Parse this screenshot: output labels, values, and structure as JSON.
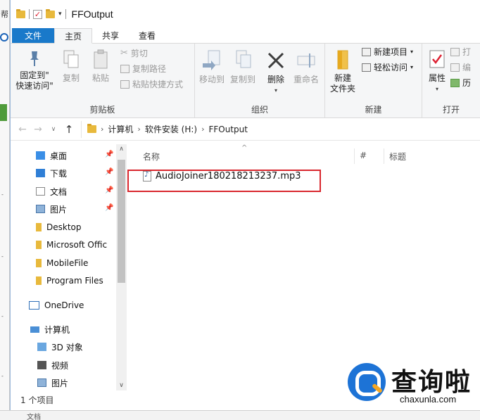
{
  "background_app": {
    "label_char": "帮",
    "bottom_text": "文档"
  },
  "window": {
    "title": "FFOutput"
  },
  "tabs": {
    "file": "文件",
    "home": "主页",
    "share": "共享",
    "view": "查看"
  },
  "ribbon": {
    "clipboard": {
      "label": "剪贴板",
      "pin_line1": "固定到\"",
      "pin_line2": "快速访问\"",
      "copy": "复制",
      "paste": "粘贴",
      "cut": "剪切",
      "copy_path": "复制路径",
      "paste_shortcut": "粘贴快捷方式"
    },
    "organize": {
      "label": "组织",
      "move_to": "移动到",
      "copy_to": "复制到",
      "delete": "删除",
      "rename": "重命名"
    },
    "new": {
      "label": "新建",
      "new_folder_line1": "新建",
      "new_folder_line2": "文件夹",
      "new_item": "新建项目",
      "easy_access": "轻松访问"
    },
    "open": {
      "label": "打开",
      "properties": "属性",
      "open": "打",
      "edit": "编",
      "history": "历"
    }
  },
  "address": {
    "crumbs": [
      "计算机",
      "软件安装 (H:)",
      "FFOutput"
    ]
  },
  "nav": {
    "quick_access": [
      {
        "label": "桌面",
        "pinned": true
      },
      {
        "label": "下载",
        "pinned": true
      },
      {
        "label": "文档",
        "pinned": true
      },
      {
        "label": "图片",
        "pinned": true
      },
      {
        "label": "Desktop",
        "pinned": false
      },
      {
        "label": "Microsoft Offic",
        "pinned": false
      },
      {
        "label": "MobileFile",
        "pinned": false
      },
      {
        "label": "Program Files",
        "pinned": false
      }
    ],
    "onedrive": "OneDrive",
    "computer": "计算机",
    "computer_items": [
      "3D 对象",
      "视频",
      "图片"
    ]
  },
  "columns": {
    "name": "名称",
    "number": "#",
    "title": "标题"
  },
  "files": [
    {
      "name": "AudioJoiner180218213237.mp3"
    }
  ],
  "status": {
    "count": "1 个项目"
  },
  "watermark": {
    "cn": "查询啦",
    "en": "chaxunla.com"
  },
  "colors": {
    "file_tab": "#1979ca",
    "highlight_box": "#d9272e",
    "folder": "#e8b93c",
    "watermark_blue": "#1d73d6"
  }
}
